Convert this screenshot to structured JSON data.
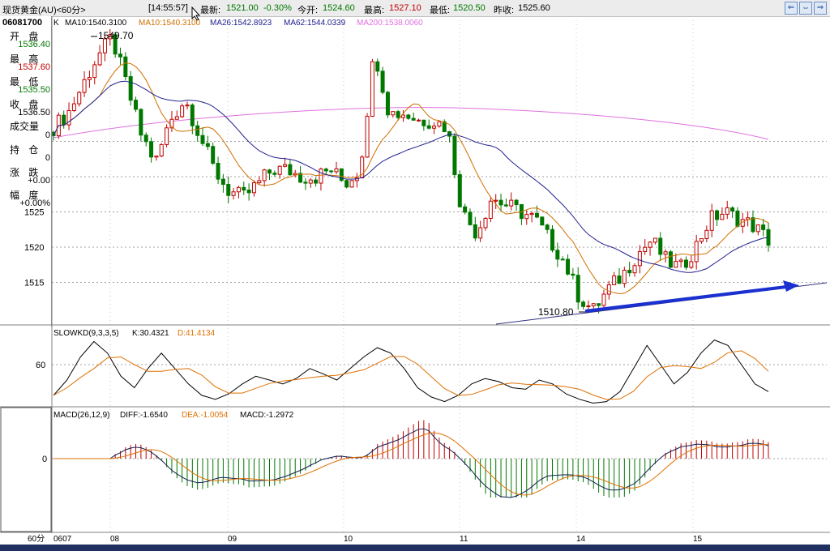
{
  "header": {
    "title": "现货黄金(AU)<60分>",
    "time": "[14:55:57]",
    "latest_label": "最新:",
    "latest_value": "1521.00",
    "change_pct": "-0.30%",
    "open_label": "今开:",
    "open_value": "1524.60",
    "high_label": "最高:",
    "high_value": "1527.10",
    "low_label": "最低:",
    "low_value": "1520.50",
    "prev_label": "昨收:",
    "prev_value": "1525.60"
  },
  "window_buttons": [
    "⇐",
    "⇔",
    "⇒"
  ],
  "left_panel": {
    "date": "06081700",
    "open_label": "开 盘",
    "open_value": "1536.40",
    "high_label": "最 高",
    "high_value": "1537.60",
    "low_label": "最 低",
    "low_value": "1535.50",
    "close_label": "收 盘",
    "close_value": "1536.50",
    "volume_label": "成交量",
    "volume_value": "0",
    "position_label": "持 仓",
    "position_value": "0",
    "change_label": "涨 跌",
    "change_value": "+0.00",
    "amplitude_label": "幅 度",
    "amplitude_value": "+0.00%"
  },
  "indicators": {
    "main": {
      "prefix": "K",
      "ma10": "MA10:1540.3100",
      "ma10_dup": "MA10:1540.3100",
      "ma26": "MA26:1542.8923",
      "ma62": "MA62:1544.0339",
      "ma200": "MA200:1538.0060"
    },
    "kd": {
      "name": "SLOWKD(9,3,3,5)",
      "k": "K:30.4321",
      "d": "D:41.4134"
    },
    "macd": {
      "name": "MACD(26,12,9)",
      "diff": "DIFF:-1.6540",
      "dea": "DEA:-1.0054",
      "macd": "MACD:-1.2972"
    }
  },
  "annotations": {
    "high_marker": "1549.70",
    "low_marker": "1510.80"
  },
  "bottom_axis": {
    "period": "60分",
    "dates": [
      "0607",
      "08",
      "09",
      "10",
      "11",
      "14",
      "15"
    ]
  },
  "colors": {
    "up": "#c00000",
    "down": "#007800",
    "ma10": "#d07000",
    "ma26": "#202090",
    "ma200": "#e070e0",
    "trend_arrow": "#1a30d0",
    "k_line": "#000000",
    "d_line": "#e07000",
    "grid": "#a0a0a0"
  },
  "chart_data": [
    {
      "type": "candlestick",
      "title": "现货黄金(AU)<60分>",
      "y_ticks": [
        1525,
        1520,
        1515
      ],
      "x_labels": [
        "0607",
        "08",
        "09",
        "10",
        "11",
        "14",
        "15"
      ],
      "close_path": [
        1537,
        1539,
        1543,
        1547,
        1549.7,
        1543,
        1536,
        1532,
        1538,
        1541,
        1536,
        1531,
        1528,
        1527,
        1529,
        1531,
        1531,
        1530,
        1530,
        1531,
        1529,
        1531,
        1548,
        1539,
        1539,
        1538,
        1538,
        1537,
        1525,
        1522,
        1527,
        1526,
        1525,
        1524,
        1521,
        1518,
        1513,
        1511,
        1514,
        1516,
        1519,
        1521,
        1518,
        1517,
        1520,
        1524,
        1525,
        1524,
        1523,
        1521
      ],
      "ma10": {
        "label": "MA10",
        "last": 1540.31
      },
      "ma26": {
        "label": "MA26",
        "last": 1542.8923
      },
      "ma62": {
        "label": "MA62",
        "last": 1544.0339
      },
      "ma200": {
        "label": "MA200",
        "last": 1538.006
      },
      "high": 1549.7,
      "low": 1510.8,
      "trend_line": "rising from 1510.80 low"
    },
    {
      "type": "line",
      "title": "SLOWKD(9,3,3,5)",
      "y_ticks": [
        60
      ],
      "series": [
        {
          "name": "K",
          "last": 30.4321
        },
        {
          "name": "D",
          "last": 41.4134
        }
      ]
    },
    {
      "type": "bar",
      "title": "MACD(26,12,9)",
      "y_ticks": [
        0
      ],
      "series": [
        {
          "name": "DIFF",
          "last": -1.654
        },
        {
          "name": "DEA",
          "last": -1.0054
        },
        {
          "name": "MACD",
          "last": -1.2972
        }
      ]
    }
  ]
}
